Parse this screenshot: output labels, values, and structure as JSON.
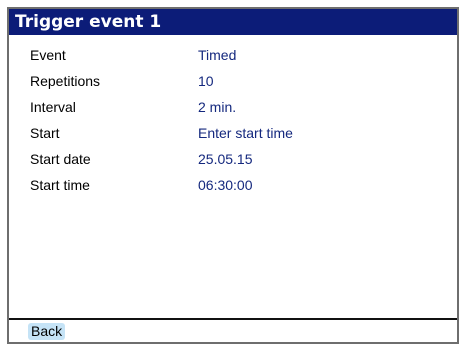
{
  "window": {
    "title": "Trigger event 1"
  },
  "settings": {
    "rows": [
      {
        "label": "Event",
        "value": "Timed"
      },
      {
        "label": "Repetitions",
        "value": "10"
      },
      {
        "label": "Interval",
        "value": "2 min."
      },
      {
        "label": "Start",
        "value": "Enter start time"
      },
      {
        "label": "Start date",
        "value": "25.05.15"
      },
      {
        "label": "Start time",
        "value": "06:30:00"
      }
    ]
  },
  "footer": {
    "back_label": "Back"
  },
  "colors": {
    "title_bar": "#0c1c78",
    "value_text": "#14287e",
    "back_highlight": "#c5e3f6"
  }
}
